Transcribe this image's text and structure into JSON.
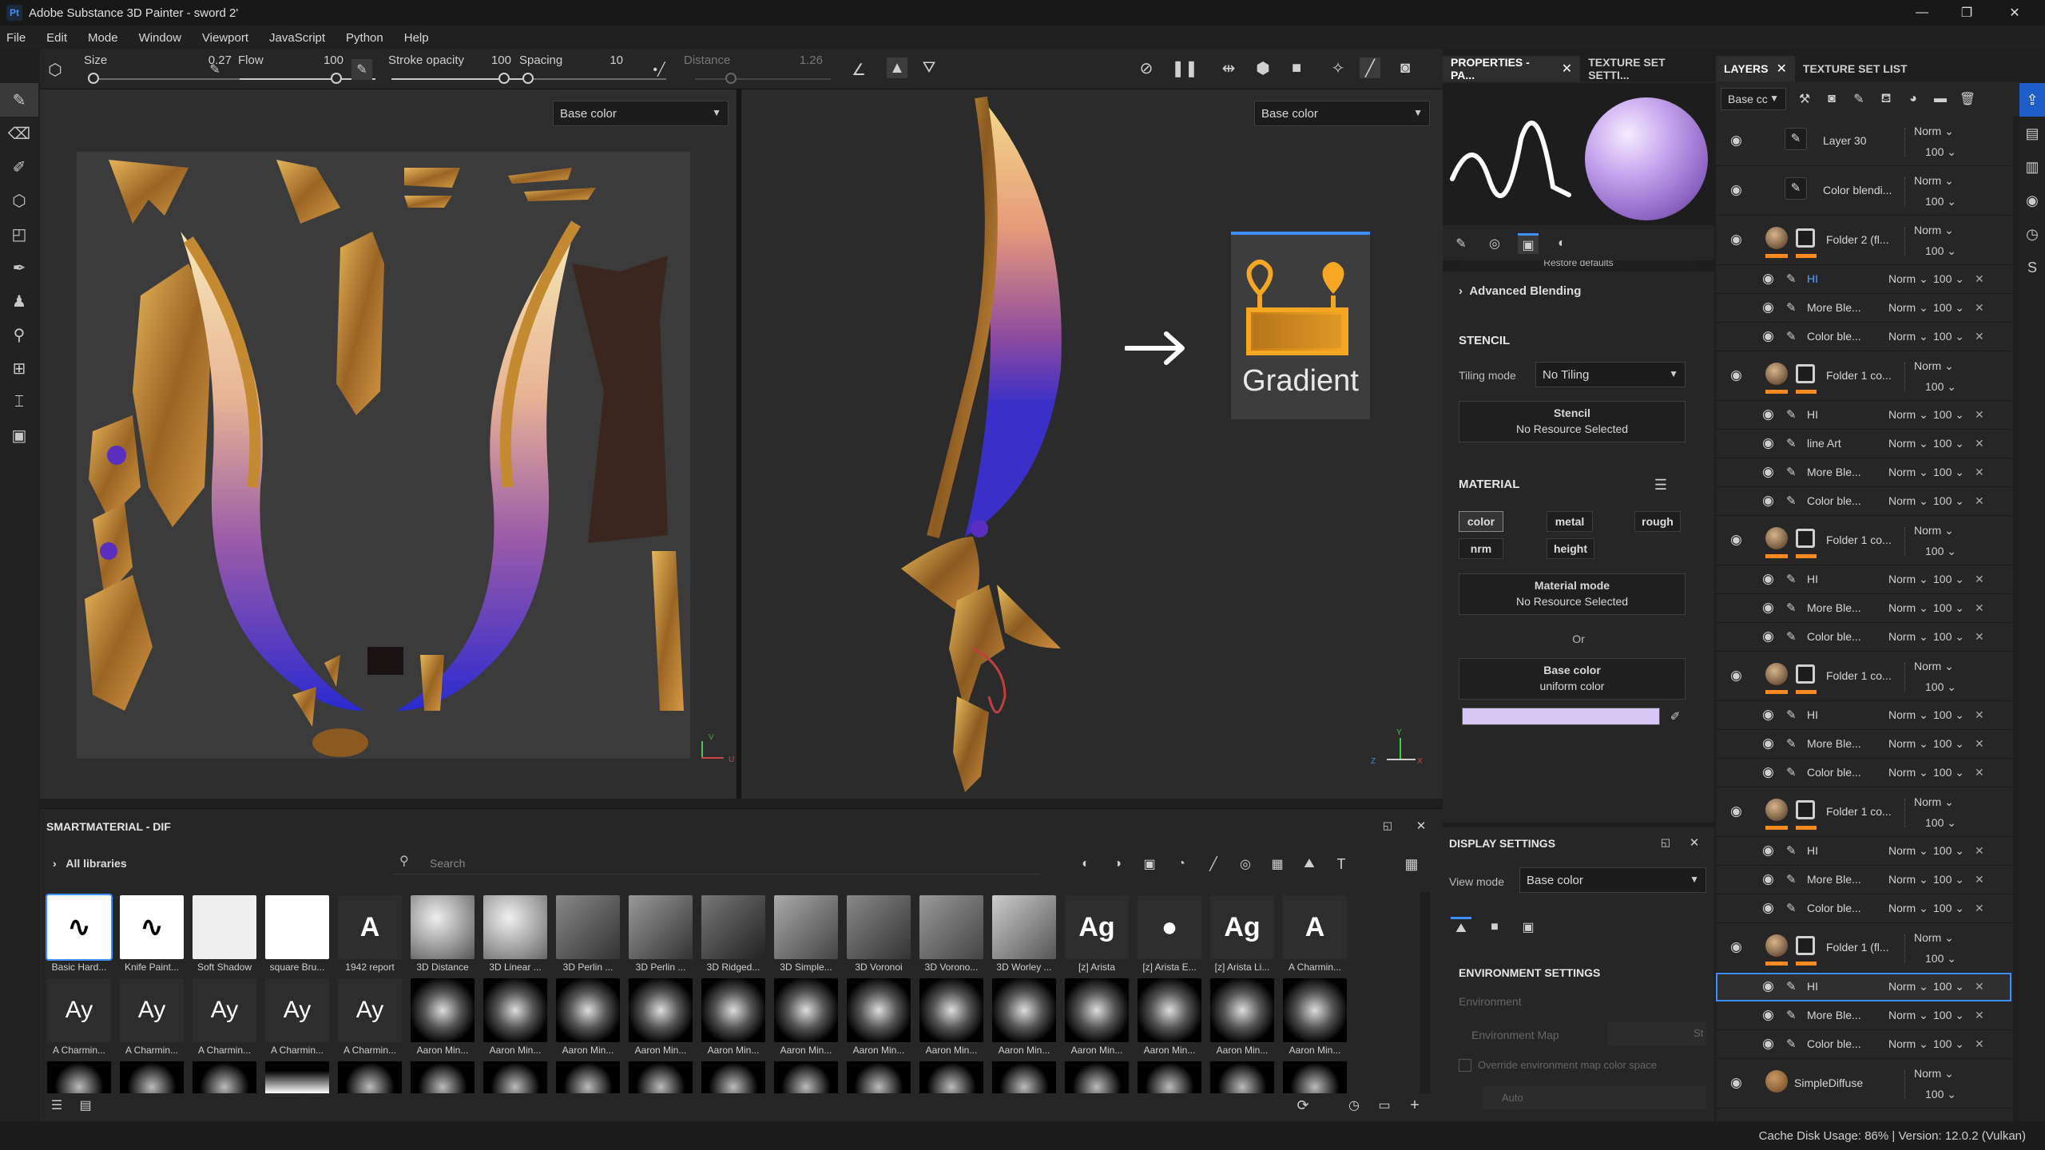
{
  "window": {
    "app_icon": "Pt",
    "title": "Adobe Substance 3D Painter - sword 2'",
    "minimize": "—",
    "maximize": "❐",
    "close": "✕"
  },
  "menu": [
    "File",
    "Edit",
    "Mode",
    "Window",
    "Viewport",
    "JavaScript",
    "Python",
    "Help"
  ],
  "toolbar": {
    "size_label": "Size",
    "size_value": "0.27",
    "flow_label": "Flow",
    "flow_value": "100",
    "stroke_label": "Stroke opacity",
    "stroke_value": "100",
    "spacing_label": "Spacing",
    "spacing_value": "10",
    "distance_label": "Distance",
    "distance_value": "1.26"
  },
  "viewport": {
    "left_channel": "Base color",
    "right_channel": "Base color",
    "gradient_label": "Gradient",
    "axis_v": "V",
    "axis_u": "U",
    "axis_y": "Y",
    "axis_x": "X",
    "axis_z": "Z"
  },
  "properties": {
    "tab1": "PROPERTIES - PA...",
    "tab2": "TEXTURE SET SETTI...",
    "restore": "Restore defaults",
    "advanced_blending": "Advanced Blending",
    "stencil_header": "STENCIL",
    "tiling_label": "Tiling mode",
    "tiling_value": "No Tiling",
    "stencil_btn_title": "Stencil",
    "stencil_btn_sub": "No Resource Selected",
    "material_header": "MATERIAL",
    "channels": [
      "color",
      "metal",
      "rough",
      "nrm",
      "height"
    ],
    "material_mode_title": "Material mode",
    "material_mode_sub": "No Resource Selected",
    "or": "Or",
    "base_color_title": "Base color",
    "base_color_sub": "uniform color",
    "base_color_swatch": "#d9c8f5"
  },
  "display": {
    "header": "DISPLAY SETTINGS",
    "view_mode_label": "View mode",
    "view_mode_value": "Base color",
    "env_header": "ENVIRONMENT SETTINGS",
    "environment": "Environment",
    "env_map": "Environment Map",
    "env_map_value": "St",
    "override": "Override environment map color space",
    "auto": "Auto"
  },
  "layers": {
    "tab1": "LAYERS",
    "tab2": "TEXTURE SET LIST",
    "channel": "Base cc",
    "rows": [
      {
        "type": "paint",
        "name": "Layer 30",
        "blend": "Norm",
        "opacity": "100"
      },
      {
        "type": "paint",
        "name": "Color blendi...",
        "blend": "Norm",
        "opacity": "100"
      },
      {
        "type": "folder",
        "name": "Folder 2 (fl...",
        "blend": "Norm",
        "opacity": "100"
      },
      {
        "type": "sub",
        "name": "HI",
        "blend": "Norm",
        "opacity": "100",
        "highlight": true
      },
      {
        "type": "sub",
        "name": "More Ble...",
        "blend": "Norm",
        "opacity": "100"
      },
      {
        "type": "sub",
        "name": "Color ble...",
        "blend": "Norm",
        "opacity": "100"
      },
      {
        "type": "folder",
        "name": "Folder 1 co...",
        "blend": "Norm",
        "opacity": "100"
      },
      {
        "type": "sub",
        "name": "HI",
        "blend": "Norm",
        "opacity": "100"
      },
      {
        "type": "sub",
        "name": "line Art",
        "blend": "Norm",
        "opacity": "100"
      },
      {
        "type": "sub",
        "name": "More Ble...",
        "blend": "Norm",
        "opacity": "100"
      },
      {
        "type": "sub",
        "name": "Color ble...",
        "blend": "Norm",
        "opacity": "100"
      },
      {
        "type": "folder",
        "name": "Folder 1 co...",
        "blend": "Norm",
        "opacity": "100"
      },
      {
        "type": "sub",
        "name": "HI",
        "blend": "Norm",
        "opacity": "100"
      },
      {
        "type": "sub",
        "name": "More Ble...",
        "blend": "Norm",
        "opacity": "100"
      },
      {
        "type": "sub",
        "name": "Color ble...",
        "blend": "Norm",
        "opacity": "100"
      },
      {
        "type": "folder",
        "name": "Folder 1 co...",
        "blend": "Norm",
        "opacity": "100"
      },
      {
        "type": "sub",
        "name": "HI",
        "blend": "Norm",
        "opacity": "100"
      },
      {
        "type": "sub",
        "name": "More Ble...",
        "blend": "Norm",
        "opacity": "100"
      },
      {
        "type": "sub",
        "name": "Color ble...",
        "blend": "Norm",
        "opacity": "100"
      },
      {
        "type": "folder",
        "name": "Folder 1 co...",
        "blend": "Norm",
        "opacity": "100"
      },
      {
        "type": "sub",
        "name": "HI",
        "blend": "Norm",
        "opacity": "100"
      },
      {
        "type": "sub",
        "name": "More Ble...",
        "blend": "Norm",
        "opacity": "100"
      },
      {
        "type": "sub",
        "name": "Color ble...",
        "blend": "Norm",
        "opacity": "100"
      },
      {
        "type": "folder",
        "name": "Folder 1 (fl...",
        "blend": "Norm",
        "opacity": "100"
      },
      {
        "type": "sub",
        "name": "HI",
        "blend": "Norm",
        "opacity": "100",
        "selected": true
      },
      {
        "type": "sub",
        "name": "More Ble...",
        "blend": "Norm",
        "opacity": "100"
      },
      {
        "type": "sub",
        "name": "Color ble...",
        "blend": "Norm",
        "opacity": "100"
      },
      {
        "type": "fill",
        "name": "SimpleDiffuse",
        "blend": "Norm",
        "opacity": "100"
      }
    ]
  },
  "shelf": {
    "header": "SMARTMATERIAL - DIF",
    "all_libraries": "All libraries",
    "search_placeholder": "Search",
    "row1": [
      "Basic Hard...",
      "Knife Paint...",
      "Soft Shadow",
      "square Bru...",
      "1942 report",
      "3D Distance",
      "3D Linear ...",
      "3D Perlin ...",
      "3D Perlin ...",
      "3D Ridged...",
      "3D Simple...",
      "3D Voronoi",
      "3D Vorono...",
      "3D Worley ...",
      "[z] Arista",
      "[z] Arista E...",
      "[z] Arista Li...",
      "A Charmin..."
    ],
    "row2": [
      "A Charmin...",
      "A Charmin...",
      "A Charmin...",
      "A Charmin...",
      "A Charmin...",
      "Aaron Min...",
      "Aaron Min...",
      "Aaron Min...",
      "Aaron Min...",
      "Aaron Min...",
      "Aaron Min...",
      "Aaron Min...",
      "Aaron Min...",
      "Aaron Min...",
      "Aaron Min...",
      "Aaron Min...",
      "Aaron Min...",
      "Aaron Min..."
    ]
  },
  "status": {
    "text": "Cache Disk Usage:   86% | Version: 12.0.2 (Vulkan)"
  }
}
